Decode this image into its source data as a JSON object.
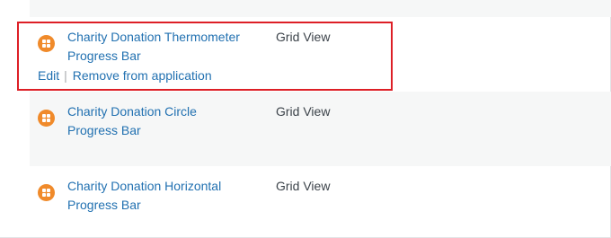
{
  "colors": {
    "link": "#2271b1",
    "text": "#3c434a",
    "row_shade": "#f6f7f7",
    "icon_bg": "#f08a2a",
    "highlight": "#dd1f26"
  },
  "rows": [
    {
      "icon": "grid-app-icon",
      "title_line1": "Charity Donation Thermometer",
      "title_line2": "Progress Bar",
      "view": "Grid View",
      "actions": {
        "edit": "Edit",
        "remove": "Remove from application"
      }
    },
    {
      "icon": "grid-app-icon",
      "title_line1": "Charity Donation Circle",
      "title_line2": "Progress Bar",
      "view": "Grid View"
    },
    {
      "icon": "grid-app-icon",
      "title_line1": "Charity Donation Horizontal",
      "title_line2": "Progress Bar",
      "view": "Grid View"
    }
  ]
}
